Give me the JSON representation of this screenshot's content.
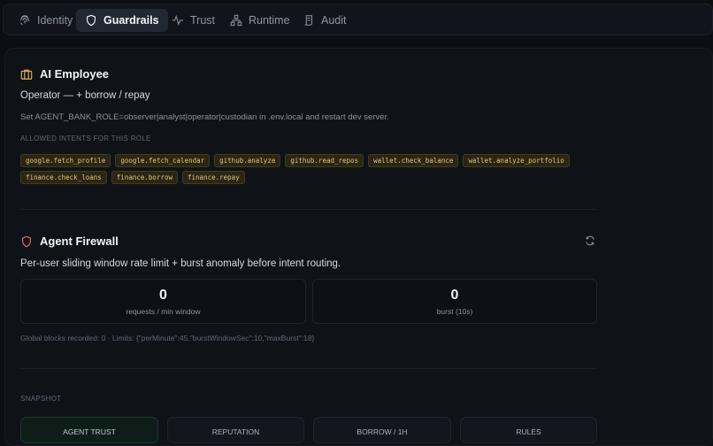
{
  "nav": {
    "tabs": [
      {
        "label": "Identity",
        "icon": "fingerprint-icon",
        "active": false
      },
      {
        "label": "Guardrails",
        "icon": "shield-icon",
        "active": true
      },
      {
        "label": "Trust",
        "icon": "activity-icon",
        "active": false
      },
      {
        "label": "Runtime",
        "icon": "network-icon",
        "active": false
      },
      {
        "label": "Audit",
        "icon": "scroll-icon",
        "active": false
      }
    ]
  },
  "employee": {
    "title": "AI Employee",
    "role_line": "Operator — + borrow / repay",
    "hint": "Set AGENT_BANK_ROLE=observer|analyst|operator|custodian in .env.local and restart dev server.",
    "allowed_label": "ALLOWED INTENTS FOR THIS ROLE",
    "intents": [
      "google.fetch_profile",
      "google.fetch_calendar",
      "github.analyze",
      "github.read_repos",
      "wallet.check_balance",
      "wallet.analyze_portfolio",
      "finance.check_loans",
      "finance.borrow",
      "finance.repay"
    ]
  },
  "firewall": {
    "title": "Agent Firewall",
    "description": "Per-user sliding window rate limit + burst anomaly before intent routing.",
    "stats": [
      {
        "value": "0",
        "label": "requests / min window"
      },
      {
        "value": "0",
        "label": "burst (10s)"
      }
    ],
    "limits_text": "Global blocks recorded: 0 · Limits: {\"perMinute\":45,\"burstWindowSec\":10,\"maxBurst\":18}"
  },
  "snapshot": {
    "label": "SNAPSHOT",
    "cards": [
      "AGENT TRUST",
      "REPUTATION",
      "BORROW / 1H",
      "RULES"
    ]
  },
  "colors": {
    "accent_gold": "#e3b24a",
    "accent_red": "#e0646a",
    "trust_green": "#0f1d19"
  }
}
